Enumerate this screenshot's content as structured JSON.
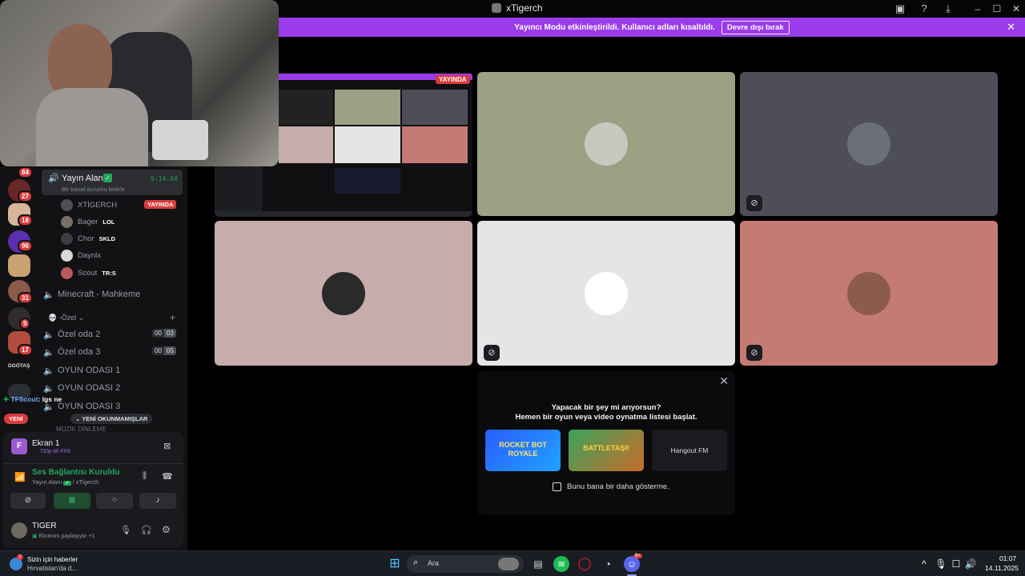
{
  "window": {
    "title": "xTigerch"
  },
  "banner": {
    "message": "Yayıncı Modu etkinleştirildi. Kullanıcı adları kısaltıldı.",
    "button": "Devre dışı bırak"
  },
  "rail": {
    "badges": [
      "84",
      "27",
      "18",
      "96",
      "31",
      "9",
      "17"
    ],
    "label": "DGÖTAŞ",
    "new_pill": "YENİ"
  },
  "sidebar": {
    "active_channel": {
      "name": "Yayın Alanı",
      "timer": "5:14:04",
      "status_placeholder": "Bir kanal durumu belirle"
    },
    "users": [
      {
        "name": "XTİGERCH",
        "badge": "YAYINDA",
        "color": "#4e5058"
      },
      {
        "name": "Bager",
        "badge": "LOL",
        "color": "#7a6f66"
      },
      {
        "name": "Chor",
        "badge": "SKLD",
        "color": "#3b3f44"
      },
      {
        "name": "Daynlx",
        "badge": "",
        "color": "#d9d9d9"
      },
      {
        "name": "Scout",
        "badge": "TR:S",
        "color": "#b85a5a"
      }
    ],
    "channels": [
      {
        "name": "Minecraft - Mahkeme",
        "left": "",
        "right": ""
      },
      {
        "name": "Özel oda 2",
        "left": "00",
        "right": "03"
      },
      {
        "name": "Özel oda 3",
        "left": "00",
        "right": "05"
      },
      {
        "name": "OYUN ODASI 1",
        "left": "",
        "right": ""
      },
      {
        "name": "OYUN ODASI 2",
        "left": "",
        "right": ""
      },
      {
        "name": "OYUN ODASI 3",
        "left": "",
        "right": ""
      }
    ],
    "category": "Özel",
    "chat_overlay": {
      "user": "TFScout",
      "text": ": lgs ne"
    },
    "unread_pill": "YENİ OKUNMAMIŞLAR",
    "cut_channel": "MÜZİK DİNLEME"
  },
  "panel": {
    "screen_title": "Ekran 1",
    "screen_quality": "720p 60 FPS",
    "voice_status": "Ses Bağlantısı Kuruldu",
    "voice_channel": "Yayın Alanı",
    "voice_server": "/ xTigerch",
    "username": "TIGER",
    "user_status": "Ekranını paylaşıyor",
    "user_extra": "+1"
  },
  "stream": {
    "live_badge": "YAYINDA"
  },
  "tiles": [
    {
      "bg": "#9da183",
      "avatar": "#c9c8c0",
      "muted": false
    },
    {
      "bg": "#4e4e58",
      "avatar": "#6c6f75",
      "muted": true
    },
    {
      "bg": "#c6acaa",
      "avatar": "#2b2a2a",
      "muted": false
    },
    {
      "bg": "#e5e5e5",
      "avatar": "#ffffff",
      "muted": true
    },
    {
      "bg": "#c47b74",
      "avatar": "#8d5b4a",
      "muted": true
    }
  ],
  "activity": {
    "line1": "Yapacak bir şey mi arıyorsun?",
    "line2": "Hemen bir oyun veya video oynatma listesi başlat.",
    "games": [
      "ROCKET BOT ROYALE",
      "BATTLETAŞI!",
      "Hangout FM"
    ],
    "checkbox": "Bunu bana bir daha gösterme."
  },
  "taskbar": {
    "news_title": "Sizin için haberler",
    "news_sub": "Hırvatistan'da d...",
    "news_badge": "7",
    "search": "Ara",
    "time": "01:07",
    "date": "14.11.2025",
    "discord_badge": "9+"
  }
}
